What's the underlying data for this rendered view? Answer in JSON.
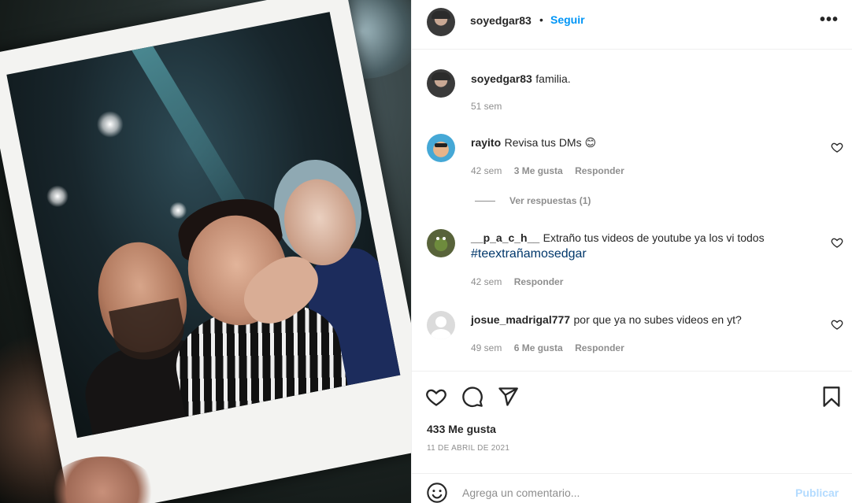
{
  "post": {
    "author": "soyedgar83",
    "separator": "•",
    "follow_label": "Seguir",
    "more_label": "•••"
  },
  "caption": {
    "username": "soyedgar83",
    "text": "familia.",
    "time": "51 sem"
  },
  "comments": [
    {
      "username": "rayito",
      "text": "Revisa tus DMs 😊",
      "time": "42 sem",
      "likes": "3 Me gusta",
      "reply_label": "Responder",
      "view_replies": "Ver respuestas (1)"
    },
    {
      "username": "__p_a_c_h__",
      "text": "Extraño tus videos de youtube ya los vi todos",
      "hashtag": "#teextrañamosedgar",
      "time": "42 sem",
      "reply_label": "Responder"
    },
    {
      "username": "josue_madrigal777",
      "text": "por que ya no subes videos en yt?",
      "time": "49 sem",
      "likes": "6 Me gusta",
      "reply_label": "Responder"
    }
  ],
  "footer": {
    "likes": "433 Me gusta",
    "date": "11 DE ABRIL DE 2021"
  },
  "composer": {
    "placeholder": "Agrega un comentario...",
    "publish_label": "Publicar"
  },
  "colors": {
    "accent": "#0095f6",
    "hashtag": "#00376b",
    "muted": "#8e8e8e",
    "publish_disabled": "#b3dbff"
  },
  "icons": {
    "like": "heart-icon",
    "comment": "comment-icon",
    "share": "paper-plane-icon",
    "save": "bookmark-icon",
    "emoji": "smiley-icon",
    "more": "more-options-icon"
  }
}
